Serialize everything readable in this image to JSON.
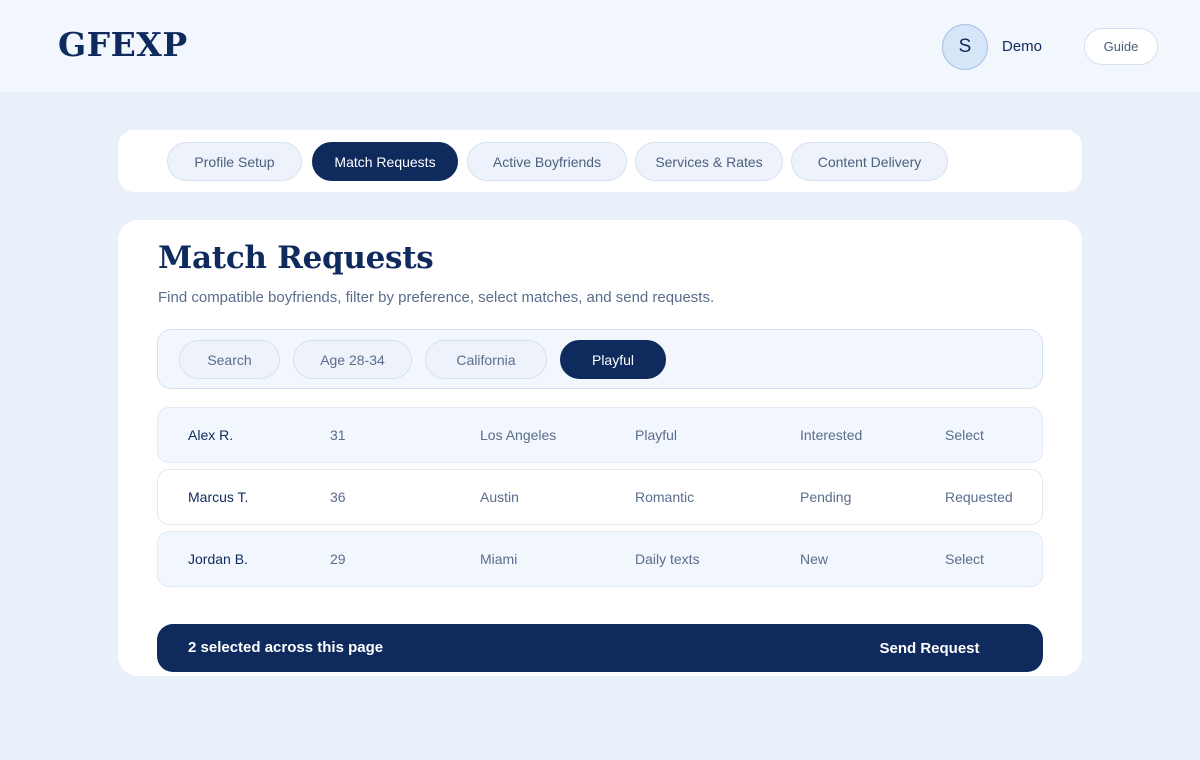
{
  "header": {
    "logo": "GFEXP",
    "avatar_initial": "S",
    "user_name": "Demo",
    "guide_label": "Guide"
  },
  "tabs": [
    {
      "label": "Profile Setup",
      "active": false
    },
    {
      "label": "Match Requests",
      "active": true
    },
    {
      "label": "Active Boyfriends",
      "active": false
    },
    {
      "label": "Services & Rates",
      "active": false
    },
    {
      "label": "Content Delivery",
      "active": false
    }
  ],
  "main": {
    "title": "Match Requests",
    "subtitle": "Find compatible boyfriends, filter by preference, select matches, and send requests."
  },
  "filters": [
    {
      "label": "Search",
      "active": false
    },
    {
      "label": "Age 28-34",
      "active": false
    },
    {
      "label": "California",
      "active": false
    },
    {
      "label": "Playful",
      "active": true
    }
  ],
  "matches": [
    {
      "name": "Alex R.",
      "age": "31",
      "location": "Los Angeles",
      "style": "Playful",
      "status": "Interested",
      "action": "Select"
    },
    {
      "name": "Marcus T.",
      "age": "36",
      "location": "Austin",
      "style": "Romantic",
      "status": "Pending",
      "action": "Requested"
    },
    {
      "name": "Jordan B.",
      "age": "29",
      "location": "Miami",
      "style": "Daily texts",
      "status": "New",
      "action": "Select"
    }
  ],
  "action_bar": {
    "selection_text": "2 selected across this page",
    "send_label": "Send Request"
  },
  "colors": {
    "primary": "#0f2a5c",
    "page_background": "#e9f0fa",
    "muted_text": "#5a6d8c"
  }
}
